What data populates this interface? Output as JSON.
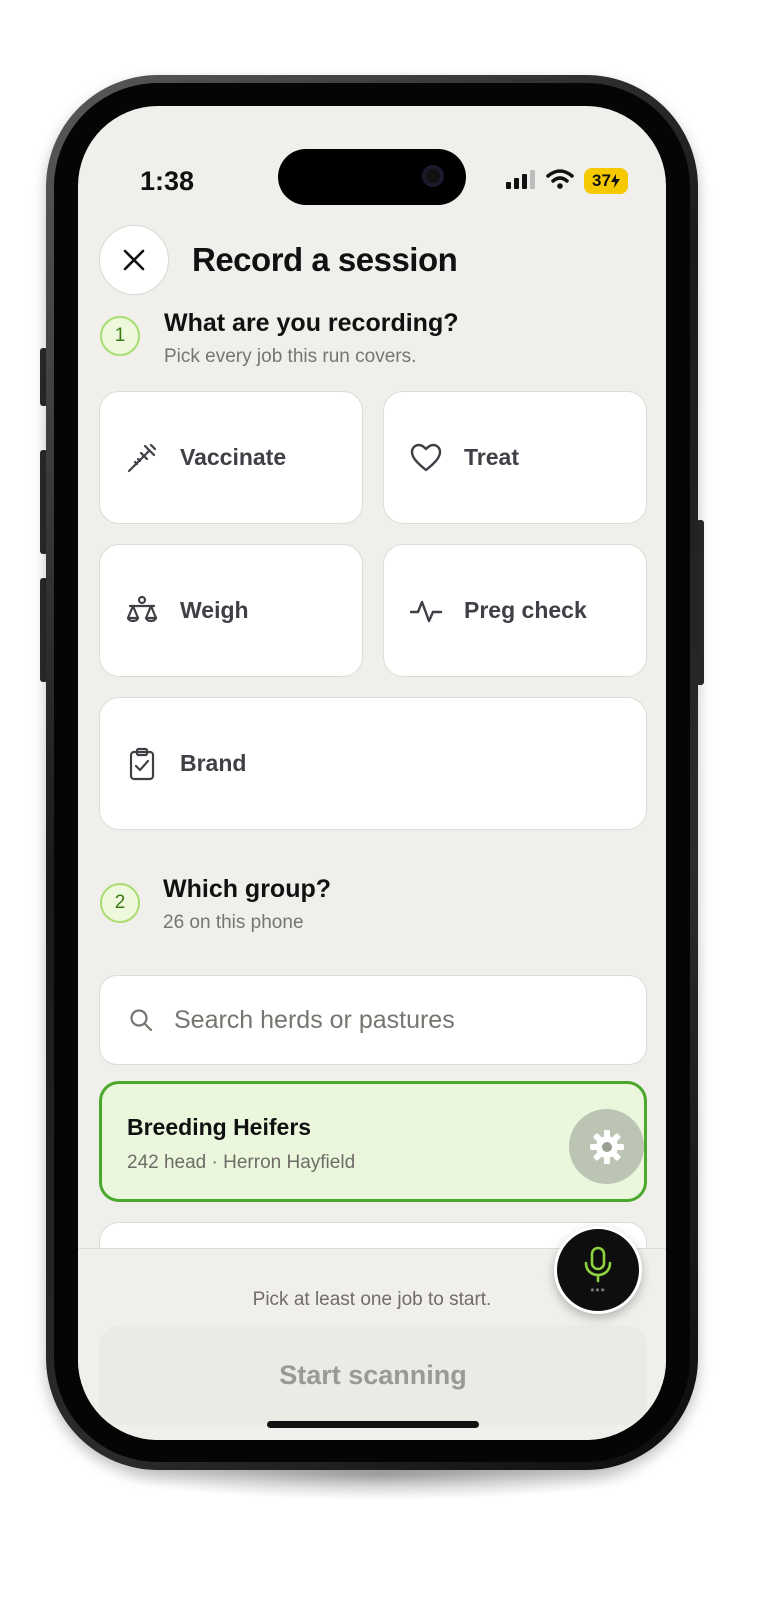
{
  "status": {
    "time": "1:38",
    "battery": "37"
  },
  "header": {
    "title": "Record a session"
  },
  "step1": {
    "number": "1",
    "title": "What are you recording?",
    "subtitle": "Pick every job this run covers.",
    "jobs": [
      {
        "label": "Vaccinate",
        "icon": "syringe-icon"
      },
      {
        "label": "Treat",
        "icon": "heart-icon"
      },
      {
        "label": "Weigh",
        "icon": "scale-icon"
      },
      {
        "label": "Preg check",
        "icon": "pulse-icon"
      },
      {
        "label": "Brand",
        "icon": "clipboard-check-icon"
      }
    ]
  },
  "step2": {
    "number": "2",
    "title": "Which group?",
    "subtitle": "26 on this phone",
    "search_placeholder": "Search herds or pastures",
    "groups": [
      {
        "name": "Breeding Heifers",
        "meta": "242 head · Herron Hayfield",
        "selected": true
      }
    ]
  },
  "footer": {
    "hint": "Pick at least one job to start.",
    "start_label": "Start scanning",
    "start_enabled": false
  },
  "colors": {
    "accent_green": "#4aa82c",
    "selected_bg": "#eaf7dd",
    "battery": "#f5c800"
  }
}
